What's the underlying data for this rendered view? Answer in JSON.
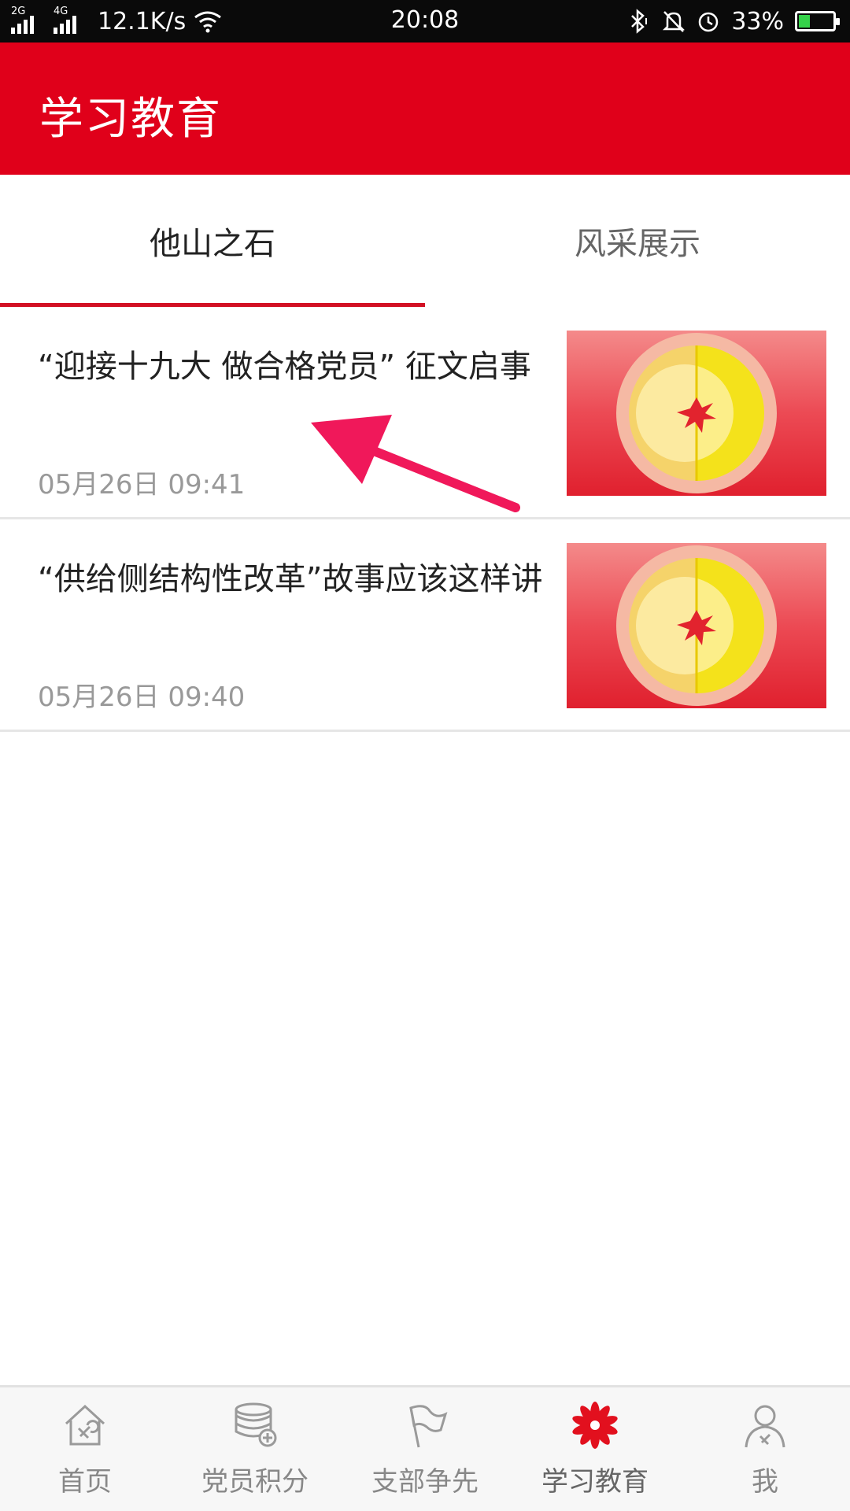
{
  "status_bar": {
    "net1": "2G",
    "net2": "4G",
    "speed": "12.1K/s",
    "time": "20:08",
    "battery_pct": "33%",
    "battery_level": 0.33,
    "icons": [
      "bluetooth-icon",
      "mute-icon",
      "alarm-icon"
    ]
  },
  "app_bar": {
    "title": "学习教育"
  },
  "tabs": [
    {
      "label": "他山之石",
      "active": true
    },
    {
      "label": "风采展示",
      "active": false
    }
  ],
  "articles": [
    {
      "title": "“迎接十九大 做合格党员” 征文启事",
      "date": "05月26日 09:41"
    },
    {
      "title": "“供给侧结构性改革”故事应该这样讲",
      "date": "05月26日 09:40"
    }
  ],
  "bottom_nav": [
    {
      "label": "首页",
      "icon": "home-icon",
      "active": false
    },
    {
      "label": "党员积分",
      "icon": "coins-icon",
      "active": false
    },
    {
      "label": "支部争先",
      "icon": "flag-icon",
      "active": false
    },
    {
      "label": "学习教育",
      "icon": "flower-icon",
      "active": true
    },
    {
      "label": "我",
      "icon": "profile-icon",
      "active": false
    }
  ],
  "colors": {
    "brand_red": "#e0001a",
    "underline": "#d21024",
    "annotation_arrow": "#f0185a"
  }
}
